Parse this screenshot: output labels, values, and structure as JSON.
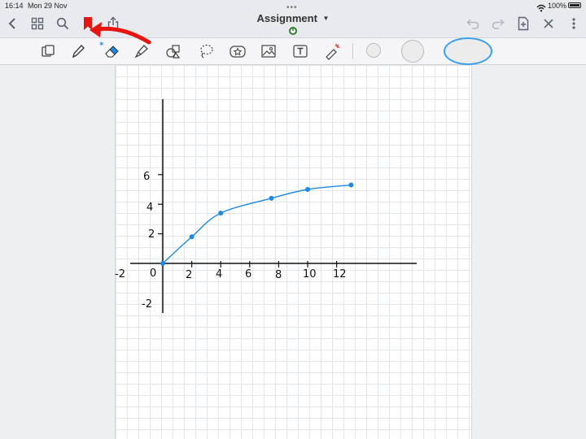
{
  "status": {
    "time": "16:14",
    "date": "Mon 29 Nov",
    "battery": "100%"
  },
  "header": {
    "title": "Assignment"
  },
  "icons": {
    "back": "chevron-left-icon",
    "grid": "grid-icon",
    "search": "search-icon",
    "bookmark": "bookmark-icon",
    "share": "share-icon",
    "undo": "undo-icon",
    "redo": "redo-icon",
    "add_page": "add-page-icon",
    "close": "close-icon"
  },
  "annotation_arrow_color": "#e8140f",
  "chart_data": {
    "type": "line",
    "x": [
      0,
      2,
      4,
      7.5,
      10,
      13
    ],
    "y": [
      0,
      1.8,
      3.4,
      4.4,
      5.0,
      5.3
    ],
    "x_ticks": [
      "-2",
      "0",
      "2",
      "4",
      "6",
      "8",
      "10",
      "12"
    ],
    "y_ticks": [
      "6",
      "4",
      "2",
      "-2"
    ],
    "series_color": "#1e88e5"
  }
}
